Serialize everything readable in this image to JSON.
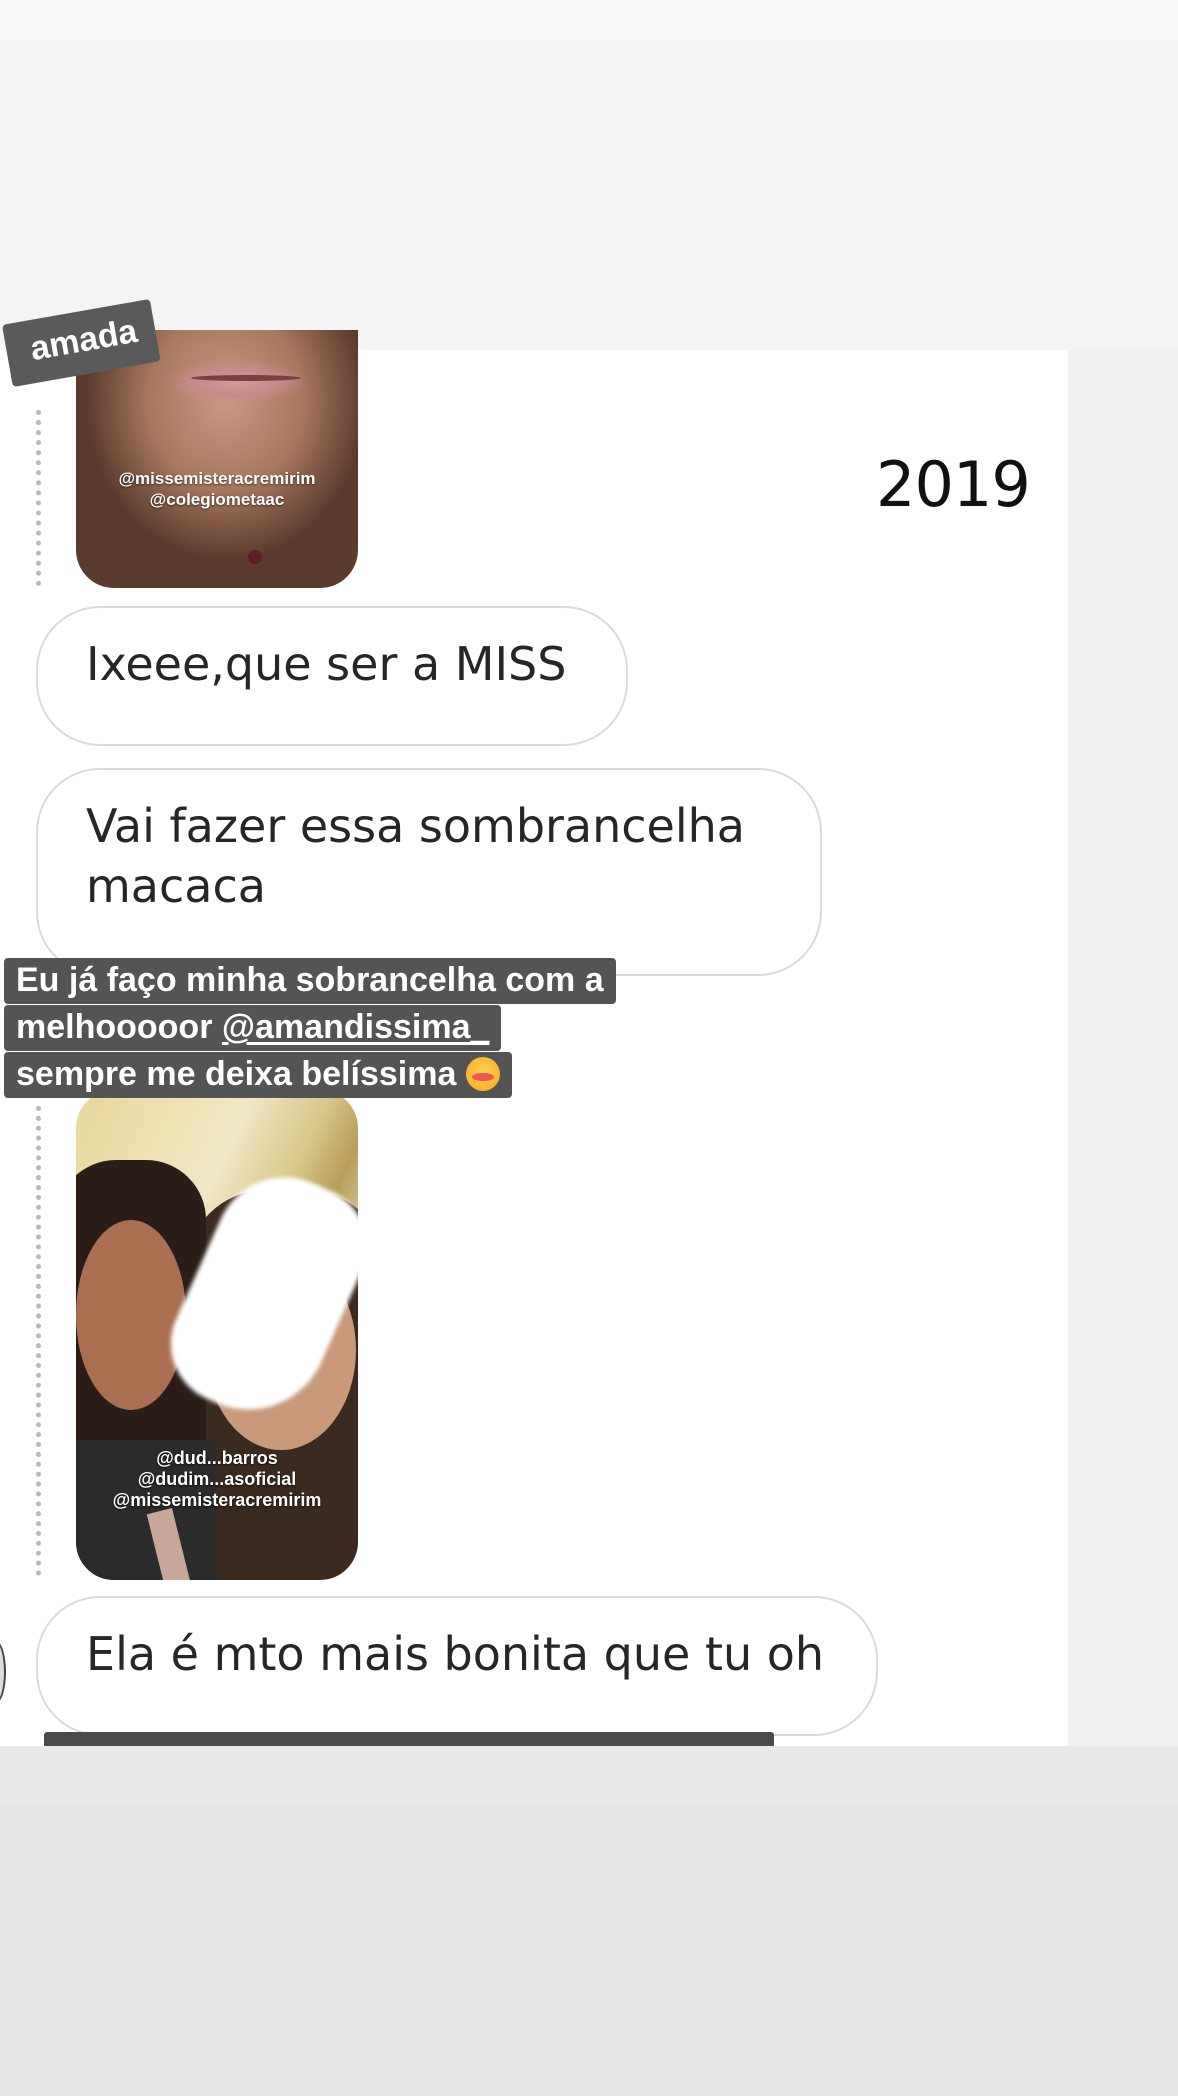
{
  "year_label": "2019",
  "top_story_tag": "amada",
  "story_1": {
    "credits": [
      "@missemisteracremirim",
      "@colegiometaac"
    ]
  },
  "messages": [
    {
      "text": "Ixeee,que ser a MISS"
    },
    {
      "text_line1": "Vai fazer essa sombrancelha",
      "text_line2": "macaca"
    },
    {
      "text": "Ela é mto mais bonita que tu oh"
    }
  ],
  "story_caption": {
    "line1": "Eu já faço minha sobrancelha com a",
    "line2_prefix": "melhooooor ",
    "line2_mention": "@amandissima_",
    "line3": "sempre me deixa belíssima",
    "emoji": "smiling-face-with-hearts"
  },
  "story_2": {
    "credits": [
      "@dud...barros",
      "@dudim...asoficial",
      "@missemisteracremirim"
    ]
  }
}
